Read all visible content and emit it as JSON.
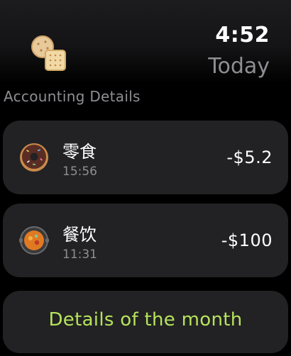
{
  "status": {
    "time": "4:52",
    "day": "Today"
  },
  "app": {
    "icon": "cookie-cracker-icon"
  },
  "section": {
    "title": "Accounting Details"
  },
  "records": [
    {
      "category": "零食",
      "time": "15:56",
      "amount": "-$5.2",
      "icon": "donut-icon"
    },
    {
      "category": "餐饮",
      "time": "11:31",
      "amount": "-$100",
      "icon": "hotpot-icon"
    }
  ],
  "month_button": {
    "label": "Details of the month"
  },
  "colors": {
    "background": "#000000",
    "card": "#222224",
    "secondary_text": "#8e8e93",
    "accent_green": "#b6e35b"
  }
}
